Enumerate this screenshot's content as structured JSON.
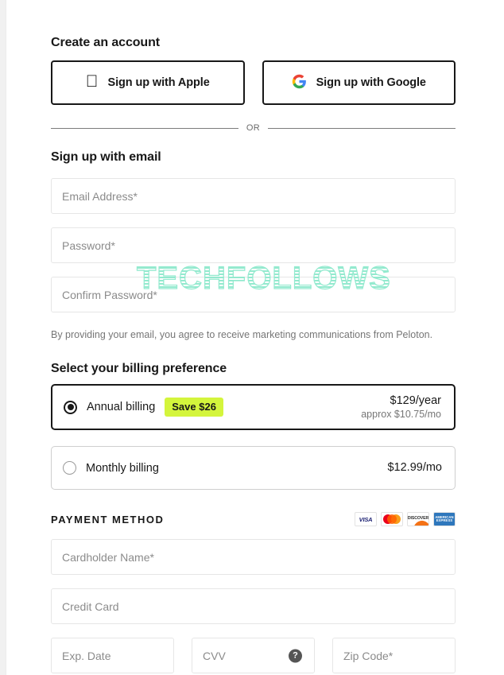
{
  "account": {
    "heading": "Create an account",
    "social_buttons": [
      {
        "label": "Sign up with Apple",
        "icon": "apple-icon"
      },
      {
        "label": "Sign up with Google",
        "icon": "google-icon"
      }
    ],
    "divider_text": "OR",
    "email_heading": "Sign up with email",
    "fields": [
      {
        "name": "email",
        "placeholder": "Email Address*",
        "value": ""
      },
      {
        "name": "password",
        "placeholder": "Password*",
        "value": ""
      },
      {
        "name": "confirm_password",
        "placeholder": "Confirm Password*",
        "value": ""
      }
    ],
    "legal_text": "By providing your email, you agree to receive marketing communications from Peloton."
  },
  "billing": {
    "heading": "Select your billing preference",
    "options": [
      {
        "id": "annual",
        "label": "Annual billing",
        "badge": "Save $26",
        "price": "$129/year",
        "price_sub": "approx $10.75/mo",
        "selected": true
      },
      {
        "id": "monthly",
        "label": "Monthly billing",
        "badge": "",
        "price": "$12.99/mo",
        "price_sub": "",
        "selected": false
      }
    ]
  },
  "payment": {
    "heading": "PAYMENT METHOD",
    "card_brands": [
      "VISA",
      "Mastercard",
      "DISCOVER",
      "AMERICAN EXPRESS"
    ],
    "brand_text": {
      "visa": "VISA",
      "discover": "DISCOVER",
      "amex_line1": "AMERICAN",
      "amex_line2": "EXPRESS"
    },
    "fields": {
      "cardholder": {
        "placeholder": "Cardholder Name*",
        "value": ""
      },
      "credit_card": {
        "placeholder": "Credit Card",
        "value": ""
      },
      "exp_date": {
        "placeholder": "Exp. Date",
        "value": ""
      },
      "cvv": {
        "placeholder": "CVV",
        "value": "",
        "help_glyph": "?"
      },
      "zip": {
        "placeholder": "Zip Code*",
        "value": ""
      }
    }
  },
  "watermark": {
    "text": "TECHFOLLOWS"
  },
  "colors": {
    "accent_badge": "#d4f53c",
    "text_primary": "#181818",
    "text_muted": "#767676",
    "border_light": "#e6e6e6",
    "watermark": "#8fe9cd"
  }
}
